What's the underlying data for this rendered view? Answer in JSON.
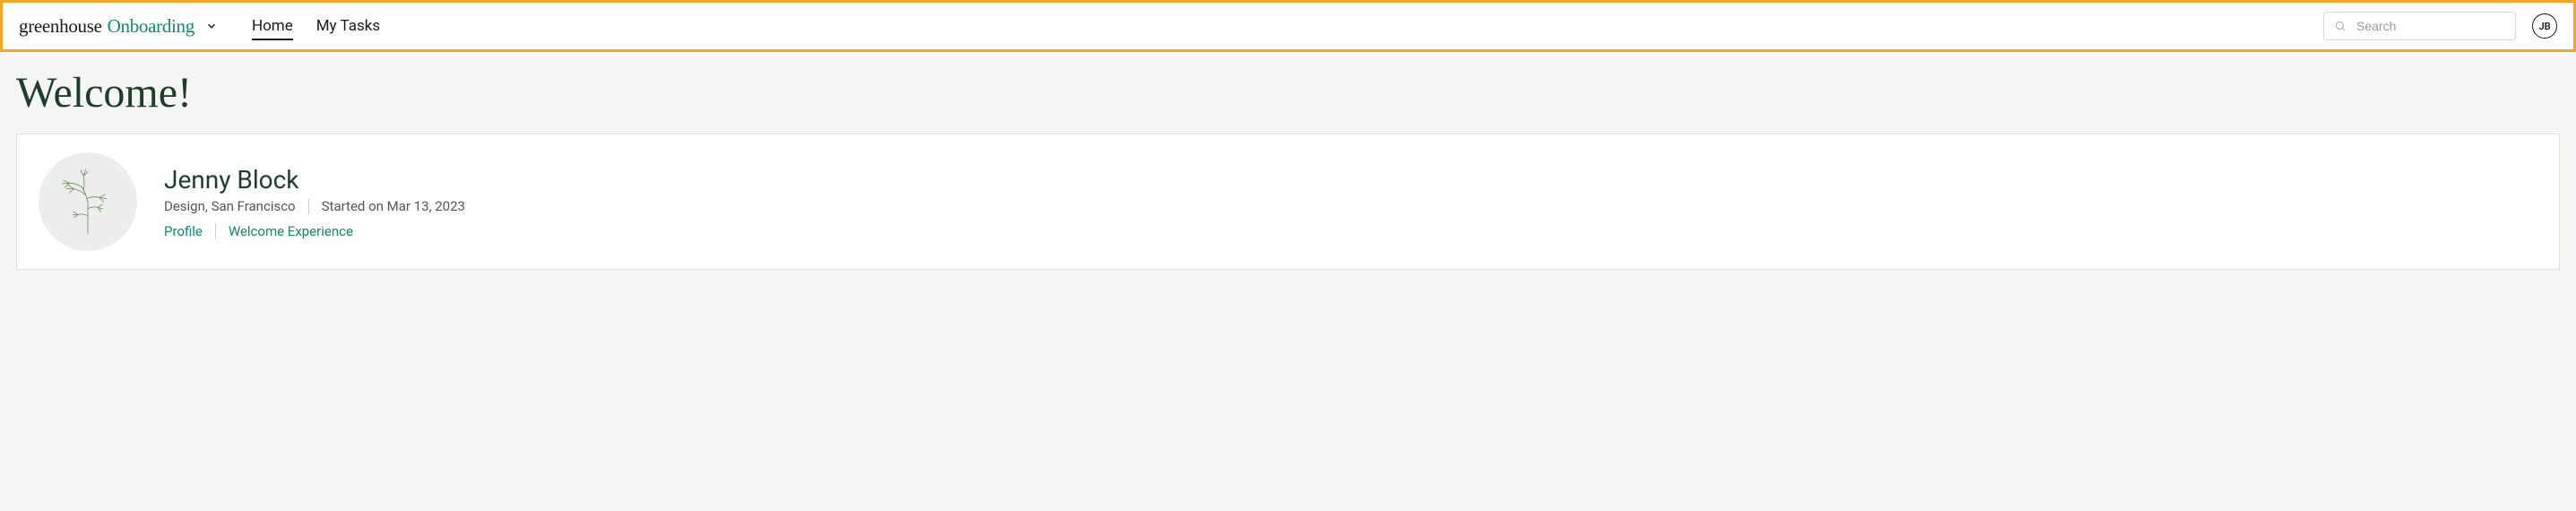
{
  "header": {
    "brand_primary": "greenhouse",
    "brand_secondary": "Onboarding",
    "nav": {
      "home": "Home",
      "my_tasks": "My Tasks"
    },
    "search_placeholder": "Search",
    "avatar_initials": "JB"
  },
  "main": {
    "title": "Welcome!",
    "user": {
      "name": "Jenny Block",
      "meta_location": "Design, San Francisco",
      "meta_started": "Started on Mar 13, 2023",
      "link_profile": "Profile",
      "link_welcome": "Welcome Experience"
    }
  }
}
